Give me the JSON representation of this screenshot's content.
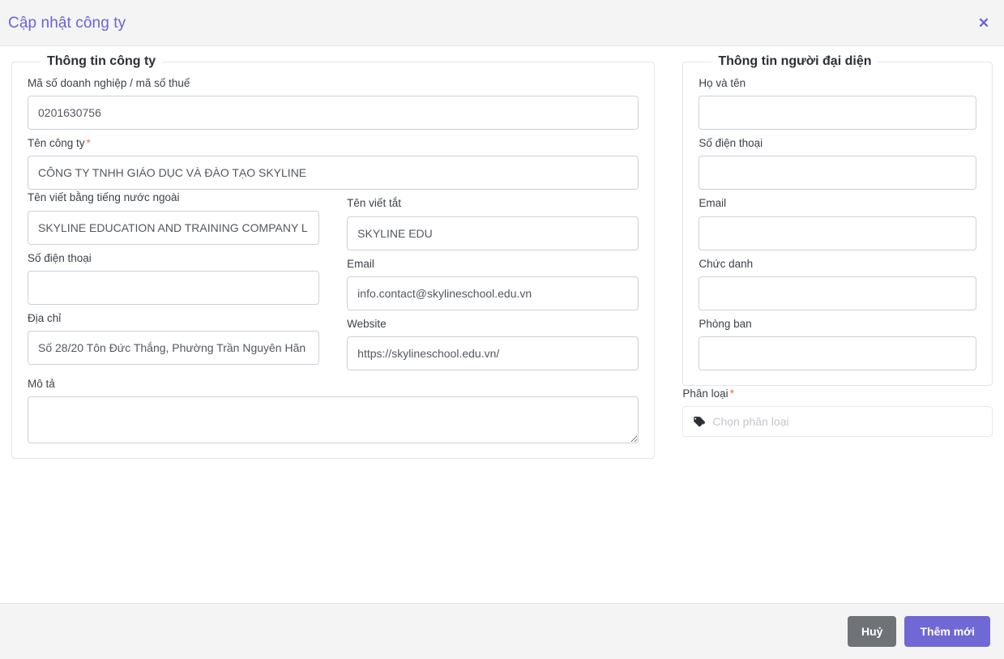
{
  "header": {
    "title": "Cập nhật công ty",
    "close_label": "✕"
  },
  "company_panel": {
    "legend": "Thông tin công ty",
    "fields": {
      "tax_code": {
        "label": "Mã số doanh nghiệp / mã số thuế",
        "value": "0201630756",
        "placeholder": ""
      },
      "company_name": {
        "label": "Tên công ty",
        "required": "*",
        "value": "CÔNG TY TNHH GIÁO DỤC VÀ ĐÀO TẠO SKYLINE",
        "placeholder": ""
      },
      "foreign_name": {
        "label": "Tên viết bằng tiếng nước ngoài",
        "value": "SKYLINE EDUCATION AND TRAINING COMPANY LIMITED",
        "placeholder": ""
      },
      "short_name": {
        "label": "Tên viết tắt",
        "value": "SKYLINE EDU",
        "placeholder": ""
      },
      "phone": {
        "label": "Số điện thoại",
        "value": "",
        "placeholder": ""
      },
      "email": {
        "label": "Email",
        "value": "info.contact@skylineschool.edu.vn",
        "placeholder": ""
      },
      "address": {
        "label": "Địa chỉ",
        "value": "Số 28/20 Tôn Đức Thắng, Phường Trần Nguyên Hãn",
        "placeholder": ""
      },
      "website": {
        "label": "Website",
        "value": "https://skylineschool.edu.vn/",
        "placeholder": ""
      },
      "description": {
        "label": "Mô tả",
        "value": "",
        "placeholder": ""
      }
    }
  },
  "representative_panel": {
    "legend": "Thông tin người đại diện",
    "fields": {
      "full_name": {
        "label": "Họ và tên",
        "value": "",
        "placeholder": ""
      },
      "phone": {
        "label": "Số điện thoại",
        "value": "",
        "placeholder": ""
      },
      "email": {
        "label": "Email",
        "value": "",
        "placeholder": ""
      },
      "job_title": {
        "label": "Chức danh",
        "value": "",
        "placeholder": ""
      },
      "department": {
        "label": "Phòng ban",
        "value": "",
        "placeholder": ""
      }
    }
  },
  "category": {
    "label": "Phân loại",
    "required": "*",
    "placeholder": "Chọn phân loại",
    "value": ""
  },
  "footer": {
    "cancel_label": "Huỷ",
    "submit_label": "Thêm mới"
  },
  "colors": {
    "accent": "#6b63d6",
    "submit_button": "#7068d4",
    "cancel_button": "#6f7277",
    "required_star": "#f4695c",
    "header_bg": "#f4f4f5",
    "input_border": "#ccd1d9"
  }
}
